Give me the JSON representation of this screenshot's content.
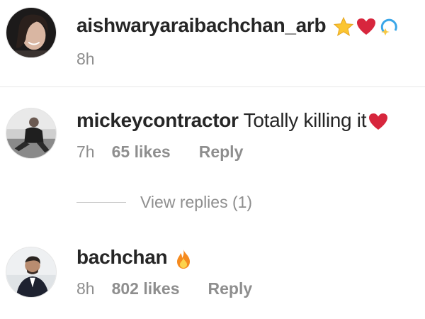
{
  "comments": [
    {
      "username": "aishwaryaraibachchan_arb",
      "text": "",
      "emojis": [
        "star-emoji",
        "red-heart-emoji",
        "dizzy-emoji"
      ],
      "time": "8h",
      "likes": "",
      "reply": ""
    },
    {
      "username": "mickeycontractor",
      "text": "Totally killing it",
      "emojis": [
        "red-heart-emoji"
      ],
      "time": "7h",
      "likes": "65 likes",
      "reply": "Reply"
    },
    {
      "username": "bachchan",
      "text": "",
      "emojis": [
        "fire-emoji"
      ],
      "time": "8h",
      "likes": "802 likes",
      "reply": "Reply"
    }
  ],
  "view_replies": "View replies (1)",
  "colors": {
    "primary_text": "#262626",
    "secondary_text": "#8e8e8e",
    "heart": "#e0245e",
    "background": "#ffffff"
  }
}
